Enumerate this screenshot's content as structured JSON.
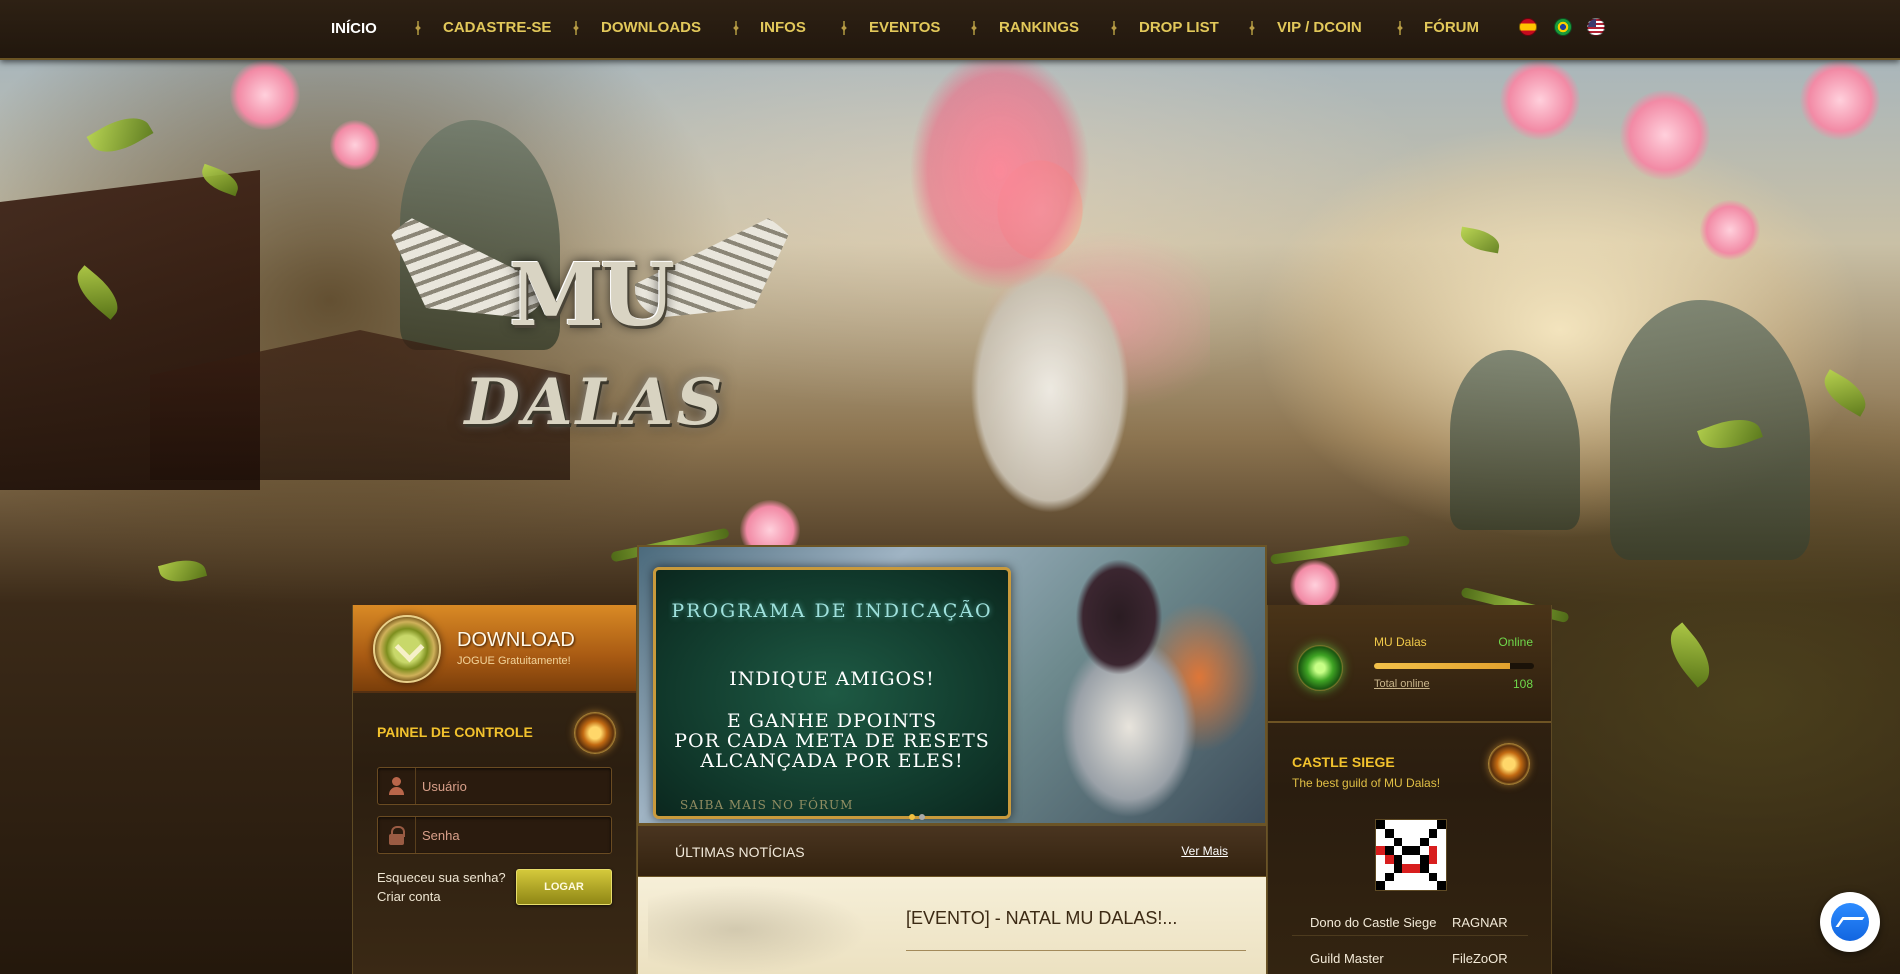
{
  "nav": {
    "items": [
      {
        "label": "INÍCIO",
        "active": true
      },
      {
        "label": "CADASTRE-SE"
      },
      {
        "label": "DOWNLOADS"
      },
      {
        "label": "INFOS"
      },
      {
        "label": "EVENTOS"
      },
      {
        "label": "RANKINGS"
      },
      {
        "label": "DROP LIST"
      },
      {
        "label": "VIP / DCOIN"
      },
      {
        "label": "FÓRUM"
      }
    ],
    "flags": [
      "flag-es-icon",
      "flag-br-icon",
      "flag-us-icon"
    ]
  },
  "logo": {
    "mu": "MU",
    "dalas": "DALAS"
  },
  "download": {
    "title": "DOWNLOAD",
    "subtitle": "JOGUE Gratuitamente!"
  },
  "login": {
    "panel_title": "PAINEL DE CONTROLE",
    "user_placeholder": "Usuário",
    "pass_placeholder": "Senha",
    "forgot": "Esqueceu sua senha?",
    "create": "Criar conta",
    "button": "LOGAR"
  },
  "banner": {
    "heading": "PROGRAMA DE INDICAÇÃO",
    "line1": "INDIQUE AMIGOS!",
    "line2": "E GANHE DPOINTS",
    "line3": "POR CADA META DE RESETS",
    "line4": "ALCANÇADA POR ELES!",
    "more": "SAIBA MAIS NO FÓRUM"
  },
  "news": {
    "title": "ÚLTIMAS NOTÍCIAS",
    "more": "Ver Mais",
    "headline": "[EVENTO] - NATAL MU DALAS!..."
  },
  "server": {
    "name": "MU Dalas",
    "state": "Online",
    "total_label": "Total online",
    "total": "108",
    "load_fraction": 0.85
  },
  "castle_siege": {
    "title": "CASTLE SIEGE",
    "subtitle": "The best guild of MU Dalas!",
    "rows": [
      {
        "key": "Dono do Castle Siege",
        "value": "RAGNAR"
      },
      {
        "key": "Guild Master",
        "value": "FileZoOR"
      }
    ]
  },
  "colors": {
    "accent_gold": "#f2c22d",
    "online_green": "#6fd84b",
    "login_button": "#d4c93b",
    "download_orange": "#d98a25"
  }
}
